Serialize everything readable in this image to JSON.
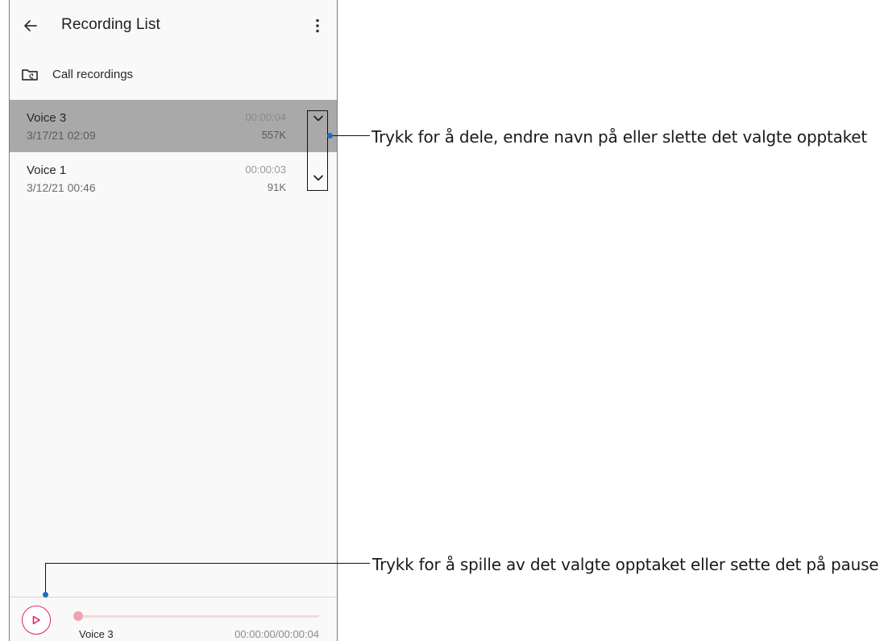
{
  "app": {
    "title": "Recording List",
    "folder_label": "Call recordings",
    "recordings": [
      {
        "name": "Voice 3",
        "date": "3/17/21 02:09",
        "duration": "00:00:04",
        "size": "557K",
        "selected": true
      },
      {
        "name": "Voice 1",
        "date": "3/12/21 00:46",
        "duration": "00:00:03",
        "size": "91K",
        "selected": false
      }
    ],
    "player": {
      "name": "Voice 3",
      "time": "00:00:00/00:00:04",
      "progress": 0
    },
    "icons": {
      "back": "arrow-left-icon",
      "menu": "more-vertical-icon",
      "folder": "folder-icon",
      "expand": "chevron-down-icon",
      "play": "play-icon"
    },
    "colors": {
      "accent": "#e0245e",
      "selected_row": "#a9a9a9",
      "callout_dot": "#1d6fb8"
    }
  },
  "annotations": {
    "expand_callout": "Trykk for å dele, endre navn på eller slette det valgte opptaket",
    "play_callout": "Trykk for å spille av det valgte opptaket eller sette det på pause"
  }
}
